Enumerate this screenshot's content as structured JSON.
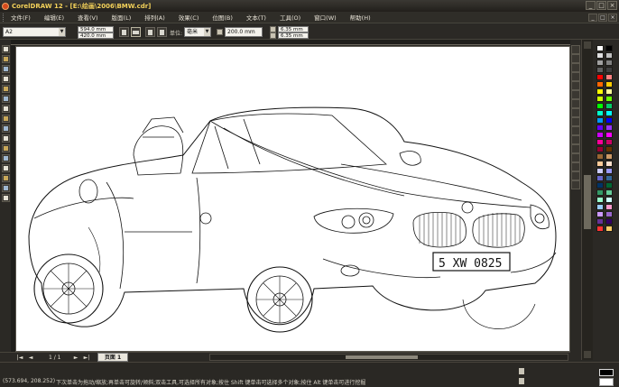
{
  "window": {
    "title": "CorelDRAW 12 - [E:\\绘画\\2006\\BMW.cdr]",
    "buttons": [
      "_",
      "□",
      "×"
    ],
    "mdi_buttons": [
      "_",
      "□",
      "×"
    ]
  },
  "menu": {
    "items": [
      "文件(F)",
      "编辑(E)",
      "查看(V)",
      "版面(L)",
      "排列(A)",
      "效果(C)",
      "位图(B)",
      "文本(T)",
      "工具(O)",
      "窗口(W)",
      "帮助(H)"
    ]
  },
  "property_bar": {
    "paper_size": "A2",
    "width": "594.0 mm",
    "height": "420.0 mm",
    "units_label": "单位:",
    "units": "毫米",
    "nudge": "200.0 mm",
    "dup_x": "6.35 mm",
    "dup_y": "6.35 mm"
  },
  "page_nav": {
    "first": "|◄",
    "prev": "◄",
    "page_count": "1 / 1",
    "next": "►",
    "last": "►|",
    "tab": "页面 1"
  },
  "status": {
    "coordinates": "(573.694, 208.252)",
    "hint": "下次单击为拖动/缩放;再单击可旋转/倾斜;双击工具,可选择所有对象;按住 Shift 键单击可选择多个对象;按住 Alt 键单击可进行挖掘"
  },
  "colors": {
    "background": "#2a2925",
    "title_text": "#f4d25a",
    "canvas": "#ffffff"
  },
  "palette": [
    "#ffffff",
    "#000000",
    "#e0e0e0",
    "#c0c0c0",
    "#a0a0a0",
    "#808080",
    "#606060",
    "#404040",
    "#ff0000",
    "#ff8080",
    "#ff6600",
    "#ffcc00",
    "#ffff00",
    "#ffff99",
    "#ccff00",
    "#66ff00",
    "#00ff00",
    "#00cc66",
    "#00ffcc",
    "#00ffff",
    "#0099ff",
    "#0000ff",
    "#6600ff",
    "#9933ff",
    "#cc00ff",
    "#ff00ff",
    "#ff0099",
    "#cc0066",
    "#990033",
    "#663300",
    "#996633",
    "#cc9966",
    "#ffcc99",
    "#ffe0cc",
    "#ccccff",
    "#9999ff",
    "#6666cc",
    "#336699",
    "#003366",
    "#006633",
    "#339966",
    "#66cc99",
    "#99ffcc",
    "#ccffff",
    "#99ccff",
    "#ff99cc",
    "#cc99ff",
    "#9966cc",
    "#663399",
    "#330066",
    "#ff3333",
    "#ffcc66"
  ],
  "toolbox": [
    "pick-tool",
    "shape-tool",
    "crop-tool",
    "zoom-tool",
    "freehand-tool",
    "smart-fill-tool",
    "rectangle-tool",
    "ellipse-tool",
    "polygon-tool",
    "basic-shapes-tool",
    "text-tool",
    "interactive-blend-tool",
    "eyedropper-tool",
    "outline-tool",
    "fill-tool",
    "interactive-fill-tool"
  ],
  "chart_data": null,
  "drawing": {
    "plate": "5 XW 0825"
  }
}
